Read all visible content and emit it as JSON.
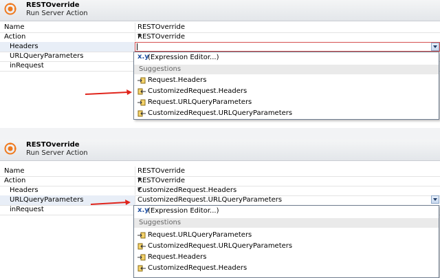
{
  "top": {
    "header": {
      "title": "RESTOverride",
      "subtitle": "Run Server Action"
    },
    "rows": [
      {
        "label": "Name",
        "value": "RESTOverride"
      },
      {
        "label": "Action",
        "value": "RESTOverride"
      },
      {
        "label": "Headers",
        "value": ""
      },
      {
        "label": "URLQueryParameters",
        "value": ""
      },
      {
        "label": "inRequest",
        "value": ""
      }
    ],
    "dropdown": {
      "expression_editor": "(Expression Editor...)",
      "expr_icon": "x.y",
      "suggestions_header": "Suggestions",
      "items": [
        {
          "label": "Request.Headers",
          "icon": "input-parameter-icon"
        },
        {
          "label": "CustomizedRequest.Headers",
          "icon": "output-parameter-icon"
        },
        {
          "label": "Request.URLQueryParameters",
          "icon": "input-parameter-icon"
        },
        {
          "label": "CustomizedRequest.URLQueryParameters",
          "icon": "output-parameter-icon"
        }
      ]
    }
  },
  "bottom": {
    "header": {
      "title": "RESTOverride",
      "subtitle": "Run Server Action"
    },
    "rows": [
      {
        "label": "Name",
        "value": "RESTOverride"
      },
      {
        "label": "Action",
        "value": "RESTOverride"
      },
      {
        "label": "Headers",
        "value": "CustomizedRequest.Headers"
      },
      {
        "label": "URLQueryParameters",
        "value": "CustomizedRequest.URLQueryParameters"
      },
      {
        "label": "inRequest",
        "value": ""
      }
    ],
    "dropdown": {
      "expression_editor": "(Expression Editor...)",
      "expr_icon": "x.y",
      "suggestions_header": "Suggestions",
      "items": [
        {
          "label": "Request.URLQueryParameters",
          "icon": "input-parameter-icon"
        },
        {
          "label": "CustomizedRequest.URLQueryParameters",
          "icon": "output-parameter-icon"
        },
        {
          "label": "Request.Headers",
          "icon": "input-parameter-icon"
        },
        {
          "label": "CustomizedRequest.Headers",
          "icon": "output-parameter-icon"
        }
      ]
    }
  },
  "colors": {
    "annotation_arrow": "#e0241b",
    "accent": "#f07a1e"
  }
}
